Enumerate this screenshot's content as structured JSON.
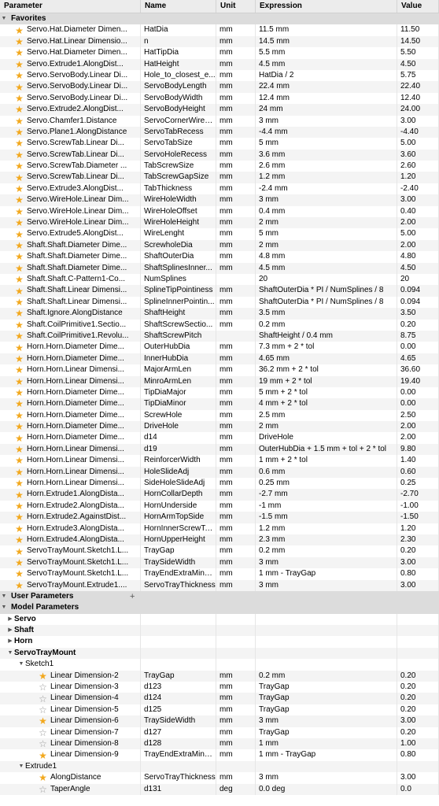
{
  "columns": [
    "Parameter",
    "Name",
    "Unit",
    "Expression",
    "Value"
  ],
  "favorites_label": "Favorites",
  "user_parameters_label": "User Parameters",
  "add_symbol": "+",
  "model_parameters_label": "Model Parameters",
  "favorites": [
    {
      "param": "Servo.Hat.Diameter Dimen...",
      "name": "HatDia",
      "unit": "mm",
      "expr": "11.5 mm",
      "value": "11.50"
    },
    {
      "param": "Servo.Hat.Linear Dimensio...",
      "name": "n",
      "unit": "mm",
      "expr": "14.5 mm",
      "value": "14.50"
    },
    {
      "param": "Servo.Hat.Diameter Dimen...",
      "name": "HatTipDia",
      "unit": "mm",
      "expr": "5.5 mm",
      "value": "5.50"
    },
    {
      "param": "Servo.Extrude1.AlongDist...",
      "name": "HatHeight",
      "unit": "mm",
      "expr": "4.5 mm",
      "value": "4.50"
    },
    {
      "param": "Servo.ServoBody.Linear Di...",
      "name": "Hole_to_closest_e...",
      "unit": "mm",
      "expr": "HatDia / 2",
      "value": "5.75"
    },
    {
      "param": "Servo.ServoBody.Linear Di...",
      "name": "ServoBodyLength",
      "unit": "mm",
      "expr": "22.4 mm",
      "value": "22.40"
    },
    {
      "param": "Servo.ServoBody.Linear Di...",
      "name": "ServoBodyWidth",
      "unit": "mm",
      "expr": "12.4 mm",
      "value": "12.40"
    },
    {
      "param": "Servo.Extrude2.AlongDist...",
      "name": "ServoBodyHeight",
      "unit": "mm",
      "expr": "24 mm",
      "value": "24.00"
    },
    {
      "param": "Servo.Chamfer1.Distance",
      "name": "ServoCornerWireR...",
      "unit": "mm",
      "expr": "3 mm",
      "value": "3.00"
    },
    {
      "param": "Servo.Plane1.AlongDistance",
      "name": "ServoTabRecess",
      "unit": "mm",
      "expr": "-4.4 mm",
      "value": "-4.40"
    },
    {
      "param": "Servo.ScrewTab.Linear Di...",
      "name": "ServoTabSize",
      "unit": "mm",
      "expr": "5 mm",
      "value": "5.00"
    },
    {
      "param": "Servo.ScrewTab.Linear Di...",
      "name": "ServoHoleRecess",
      "unit": "mm",
      "expr": "3.6 mm",
      "value": "3.60"
    },
    {
      "param": "Servo.ScrewTab.Diameter ...",
      "name": "TabScrewSize",
      "unit": "mm",
      "expr": "2.6 mm",
      "value": "2.60"
    },
    {
      "param": "Servo.ScrewTab.Linear Di...",
      "name": "TabScrewGapSize",
      "unit": "mm",
      "expr": "1.2 mm",
      "value": "1.20"
    },
    {
      "param": "Servo.Extrude3.AlongDist...",
      "name": "TabThickness",
      "unit": "mm",
      "expr": "-2.4 mm",
      "value": "-2.40"
    },
    {
      "param": "Servo.WireHole.Linear Dim...",
      "name": "WireHoleWidth",
      "unit": "mm",
      "expr": "3 mm",
      "value": "3.00"
    },
    {
      "param": "Servo.WireHole.Linear Dim...",
      "name": "WireHoleOffset",
      "unit": "mm",
      "expr": "0.4 mm",
      "value": "0.40"
    },
    {
      "param": "Servo.WireHole.Linear Dim...",
      "name": "WireHoleHeight",
      "unit": "mm",
      "expr": "2 mm",
      "value": "2.00"
    },
    {
      "param": "Servo.Extrude5.AlongDist...",
      "name": "WireLenght",
      "unit": "mm",
      "expr": "5 mm",
      "value": "5.00"
    },
    {
      "param": "Shaft.Shaft.Diameter Dime...",
      "name": "ScrewholeDia",
      "unit": "mm",
      "expr": "2 mm",
      "value": "2.00"
    },
    {
      "param": "Shaft.Shaft.Diameter Dime...",
      "name": "ShaftOuterDia",
      "unit": "mm",
      "expr": "4.8 mm",
      "value": "4.80"
    },
    {
      "param": "Shaft.Shaft.Diameter Dime...",
      "name": "ShaftSplinesInner...",
      "unit": "mm",
      "expr": "4.5 mm",
      "value": "4.50"
    },
    {
      "param": "Shaft.Shaft.C-Pattern1-Co...",
      "name": "NumSplines",
      "unit": "",
      "expr": "20",
      "value": "20"
    },
    {
      "param": "Shaft.Shaft.Linear Dimensi...",
      "name": "SplineTipPointiness",
      "unit": "mm",
      "expr": "ShaftOuterDia * PI / NumSplines / 8",
      "value": "0.094"
    },
    {
      "param": "Shaft.Shaft.Linear Dimensi...",
      "name": "SplineInnerPointin...",
      "unit": "mm",
      "expr": "ShaftOuterDia * PI / NumSplines / 8",
      "value": "0.094"
    },
    {
      "param": "Shaft.Ignore.AlongDistance",
      "name": "ShaftHeight",
      "unit": "mm",
      "expr": "3.5 mm",
      "value": "3.50"
    },
    {
      "param": "Shaft.CoilPrimitive1.Sectio...",
      "name": "ShaftScrewSectio...",
      "unit": "mm",
      "expr": "0.2 mm",
      "value": "0.20"
    },
    {
      "param": "Shaft.CoilPrimitive1.Revolu...",
      "name": "ShaftScrewPitch",
      "unit": "",
      "expr": "ShaftHeight / 0.4 mm",
      "value": "8.75"
    },
    {
      "param": "Horn.Horn.Diameter Dime...",
      "name": "OuterHubDia",
      "unit": "mm",
      "expr": "7.3 mm + 2 * tol",
      "value": "0.00"
    },
    {
      "param": "Horn.Horn.Diameter Dime...",
      "name": "InnerHubDia",
      "unit": "mm",
      "expr": "4.65 mm",
      "value": "4.65"
    },
    {
      "param": "Horn.Horn.Linear Dimensi...",
      "name": "MajorArmLen",
      "unit": "mm",
      "expr": "36.2 mm + 2 * tol",
      "value": "36.60"
    },
    {
      "param": "Horn.Horn.Linear Dimensi...",
      "name": "MinroArmLen",
      "unit": "mm",
      "expr": "19 mm + 2 * tol",
      "value": "19.40"
    },
    {
      "param": "Horn.Horn.Diameter Dime...",
      "name": "TipDiaMajor",
      "unit": "mm",
      "expr": "5 mm + 2 * tol",
      "value": "0.00"
    },
    {
      "param": "Horn.Horn.Diameter Dime...",
      "name": "TipDiaMinor",
      "unit": "mm",
      "expr": "4 mm + 2 * tol",
      "value": "0.00"
    },
    {
      "param": "Horn.Horn.Diameter Dime...",
      "name": "ScrewHole",
      "unit": "mm",
      "expr": "2.5 mm",
      "value": "2.50"
    },
    {
      "param": "Horn.Horn.Diameter Dime...",
      "name": "DriveHole",
      "unit": "mm",
      "expr": "2 mm",
      "value": "2.00"
    },
    {
      "param": "Horn.Horn.Diameter Dime...",
      "name": "d14",
      "unit": "mm",
      "expr": "DriveHole",
      "value": "2.00"
    },
    {
      "param": "Horn.Horn.Linear Dimensi...",
      "name": "d19",
      "unit": "mm",
      "expr": "OuterHubDia + 1.5 mm + tol + 2 * tol",
      "value": "9.80"
    },
    {
      "param": "Horn.Horn.Linear Dimensi...",
      "name": "ReinforcerWidth",
      "unit": "mm",
      "expr": "1 mm + 2 * tol",
      "value": "1.40"
    },
    {
      "param": "Horn.Horn.Linear Dimensi...",
      "name": "HoleSlideAdj",
      "unit": "mm",
      "expr": "0.6 mm",
      "value": "0.60"
    },
    {
      "param": "Horn.Horn.Linear Dimensi...",
      "name": "SideHoleSlideAdj",
      "unit": "mm",
      "expr": "0.25 mm",
      "value": "0.25"
    },
    {
      "param": "Horn.Extrude1.AlongDista...",
      "name": "HornCollarDepth",
      "unit": "mm",
      "expr": "-2.7 mm",
      "value": "-2.70"
    },
    {
      "param": "Horn.Extrude2.AlongDista...",
      "name": "HornUnderside",
      "unit": "mm",
      "expr": "-1 mm",
      "value": "-1.00"
    },
    {
      "param": "Horn.Extrude2.AgainstDist...",
      "name": "HornArmTopSide",
      "unit": "mm",
      "expr": "-1.5 mm",
      "value": "-1.50"
    },
    {
      "param": "Horn.Extrude3.AlongDista...",
      "name": "HornInnerScrewTa...",
      "unit": "mm",
      "expr": "1.2 mm",
      "value": "1.20"
    },
    {
      "param": "Horn.Extrude4.AlongDista...",
      "name": "HornUpperHeight",
      "unit": "mm",
      "expr": "2.3 mm",
      "value": "2.30"
    },
    {
      "param": "ServoTrayMount.Sketch1.L...",
      "name": "TrayGap",
      "unit": "mm",
      "expr": "0.2 mm",
      "value": "0.20"
    },
    {
      "param": "ServoTrayMount.Sketch1.L...",
      "name": "TraySideWidth",
      "unit": "mm",
      "expr": "3 mm",
      "value": "3.00"
    },
    {
      "param": "ServoTrayMount.Sketch1.L...",
      "name": "TrayEndExtraMinus1",
      "unit": "mm",
      "expr": "1 mm - TrayGap",
      "value": "0.80"
    },
    {
      "param": "ServoTrayMount.Extrude1....",
      "name": "ServoTrayThickness",
      "unit": "mm",
      "expr": "3 mm",
      "value": "3.00"
    }
  ],
  "model_groups": [
    "Servo",
    "Shaft",
    "Horn",
    "ServoTrayMount"
  ],
  "sketch1_label": "Sketch1",
  "sketch1_rows": [
    {
      "star": true,
      "param": "Linear Dimension-2",
      "name": "TrayGap",
      "unit": "mm",
      "expr": "0.2 mm",
      "value": "0.20"
    },
    {
      "star": false,
      "param": "Linear Dimension-3",
      "name": "d123",
      "unit": "mm",
      "expr": "TrayGap",
      "value": "0.20"
    },
    {
      "star": false,
      "param": "Linear Dimension-4",
      "name": "d124",
      "unit": "mm",
      "expr": "TrayGap",
      "value": "0.20"
    },
    {
      "star": false,
      "param": "Linear Dimension-5",
      "name": "d125",
      "unit": "mm",
      "expr": "TrayGap",
      "value": "0.20"
    },
    {
      "star": true,
      "param": "Linear Dimension-6",
      "name": "TraySideWidth",
      "unit": "mm",
      "expr": "3 mm",
      "value": "3.00"
    },
    {
      "star": false,
      "param": "Linear Dimension-7",
      "name": "d127",
      "unit": "mm",
      "expr": "TrayGap",
      "value": "0.20"
    },
    {
      "star": false,
      "param": "Linear Dimension-8",
      "name": "d128",
      "unit": "mm",
      "expr": "1 mm",
      "value": "1.00"
    },
    {
      "star": true,
      "param": "Linear Dimension-9",
      "name": "TrayEndExtraMinus1",
      "unit": "mm",
      "expr": "1 mm - TrayGap",
      "value": "0.80"
    }
  ],
  "extrude1_label": "Extrude1",
  "extrude1_rows": [
    {
      "star": true,
      "param": "AlongDistance",
      "name": "ServoTrayThickness",
      "unit": "mm",
      "expr": "3 mm",
      "value": "3.00"
    },
    {
      "star": false,
      "param": "TaperAngle",
      "name": "d131",
      "unit": "deg",
      "expr": "0.0 deg",
      "value": "0.0"
    }
  ],
  "icons": {
    "favorite_on": "star-filled-icon",
    "favorite_off": "star-outline-icon",
    "expand": "triangle-down-icon",
    "collapse": "triangle-right-icon"
  },
  "colors": {
    "star_on": "#f2a81d",
    "header_bg": "#ececec",
    "section_bg": "#dcdcdc"
  }
}
